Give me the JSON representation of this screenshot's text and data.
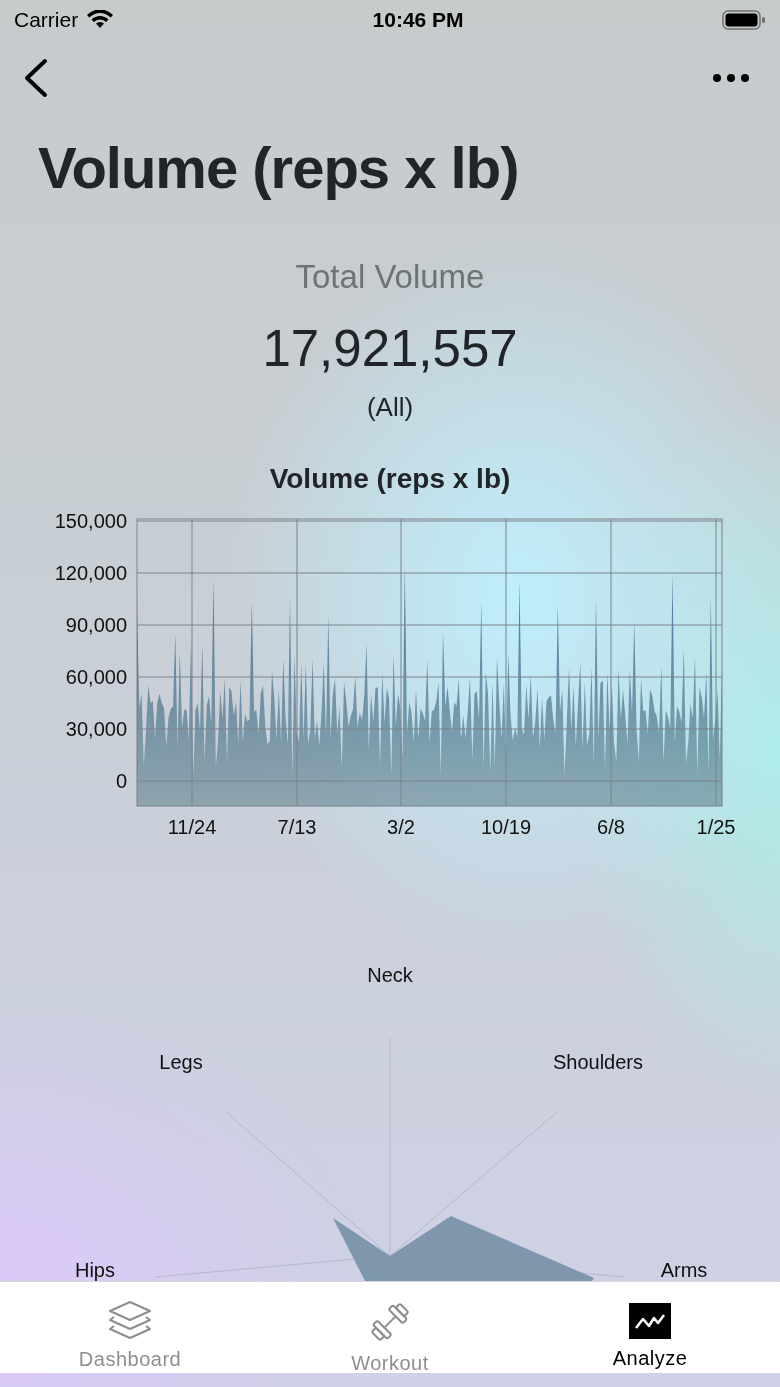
{
  "status_bar": {
    "carrier": "Carrier",
    "time": "10:46 PM"
  },
  "title": "Volume (reps x lb)",
  "summary": {
    "label": "Total Volume",
    "value": "17,921,557",
    "range": "(All)"
  },
  "chart": {
    "title": "Volume (reps x lb)",
    "yticks": [
      "150,000",
      "120,000",
      "90,000",
      "60,000",
      "30,000",
      "0"
    ],
    "xticks": [
      "11/24",
      "7/13",
      "3/2",
      "10/19",
      "6/8",
      "1/25"
    ]
  },
  "radar": {
    "axes": [
      "Neck",
      "Legs",
      "Shoulders",
      "Hips",
      "Arms"
    ]
  },
  "tabs": [
    {
      "label": "Dashboard",
      "kind": "layers",
      "selected": false
    },
    {
      "label": "Workout",
      "kind": "dumbbell",
      "selected": false
    },
    {
      "label": "Analyze",
      "kind": "chart",
      "selected": true
    }
  ]
}
